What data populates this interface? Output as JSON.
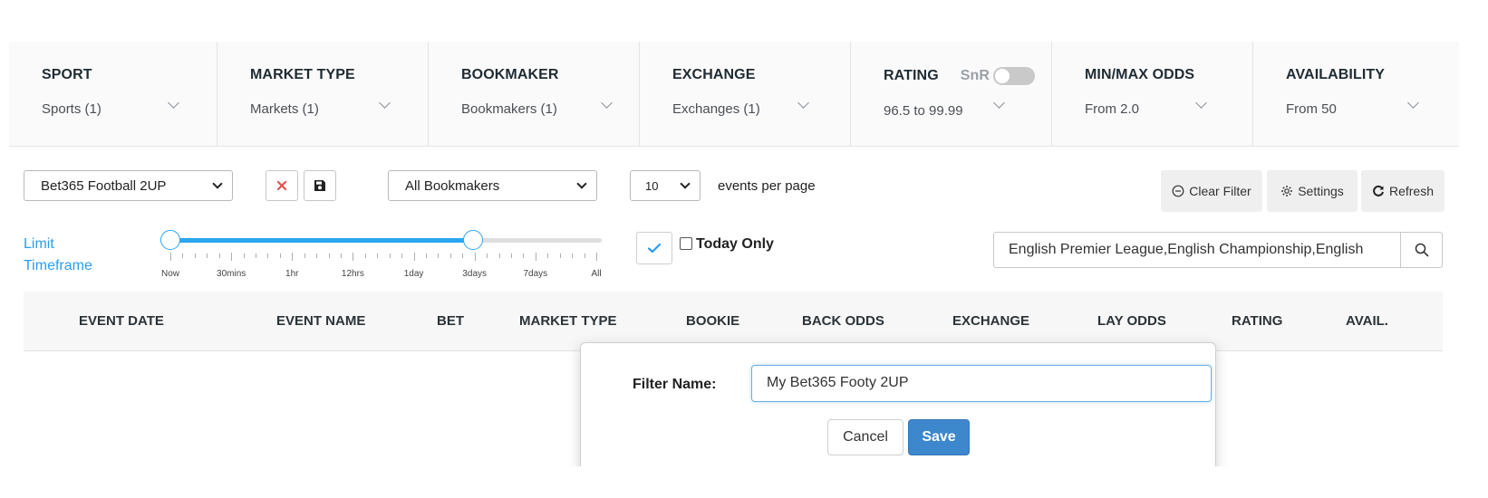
{
  "filters": [
    {
      "title": "SPORT",
      "value": "Sports (1)"
    },
    {
      "title": "MARKET TYPE",
      "value": "Markets (1)"
    },
    {
      "title": "BOOKMAKER",
      "value": "Bookmakers (1)"
    },
    {
      "title": "EXCHANGE",
      "value": "Exchanges (1)"
    },
    {
      "title": "RATING",
      "value": "96.5 to 99.99",
      "extra_label": "SnR",
      "toggle_on": false
    },
    {
      "title": "MIN/MAX ODDS",
      "value": "From 2.0"
    },
    {
      "title": "AVAILABILITY",
      "value": "From 50"
    }
  ],
  "controls": {
    "saved_filter": "Bet365 Football 2UP",
    "bookmaker_select": "All Bookmakers",
    "per_page": "10",
    "per_page_label": "events per page",
    "clear_filter": "Clear Filter",
    "settings": "Settings",
    "refresh": "Refresh"
  },
  "slider": {
    "label": "Limit Timeframe",
    "ticks": [
      "Now",
      "30mins",
      "1hr",
      "12hrs",
      "1day",
      "3days",
      "7days",
      "All"
    ],
    "range_start": "Now",
    "range_end": "3days"
  },
  "today_only": {
    "label": "Today Only",
    "checked": false
  },
  "search": {
    "value": "English Premier League,English Championship,English"
  },
  "table": {
    "headers": [
      "EVENT DATE",
      "EVENT NAME",
      "BET",
      "MARKET TYPE",
      "BOOKIE",
      "BACK ODDS",
      "EXCHANGE",
      "LAY ODDS",
      "RATING",
      "AVAIL."
    ]
  },
  "modal": {
    "label": "Filter Name:",
    "input_value": "My Bet365 Footy 2UP",
    "cancel": "Cancel",
    "save": "Save"
  },
  "colors": {
    "accent": "#2aa7f0",
    "save_button": "#3d87cd",
    "delete_icon": "#e0524f"
  }
}
